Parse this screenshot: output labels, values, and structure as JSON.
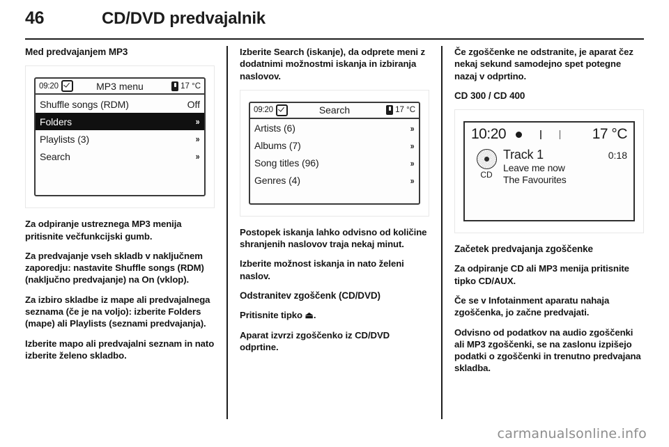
{
  "header": {
    "page_number": "46",
    "chapter_title": "CD/DVD predvajalnik"
  },
  "columns": {
    "left": {
      "heading": "Med predvajanjem MP3",
      "figure": {
        "name": "mp3-menu-screen",
        "clock": "09:20",
        "clock_icon": "clock-check-icon",
        "title": "MP3 menu",
        "temp_icon": "thermometer-icon",
        "temperature": "17 °C",
        "rows": [
          {
            "label": "Shuffle songs (RDM)",
            "value": "Off",
            "arrow": "",
            "selected": false
          },
          {
            "label": "Folders",
            "value": "",
            "arrow": "»",
            "selected": true
          },
          {
            "label": "Playlists (3)",
            "value": "",
            "arrow": "»",
            "selected": false
          },
          {
            "label": "Search",
            "value": "",
            "arrow": "»",
            "selected": false
          }
        ]
      },
      "paragraphs": [
        "Za odpiranje ustreznega MP3 menija pritisnite večfunkcijski gumb.",
        "Za predvajanje vseh skladb v naključnem zaporedju: nastavite Shuffle songs (RDM) (naključno predvajanje) na On (vklop).",
        "Za izbiro skladbe iz mape ali predvajalnega seznama (če je na voljo): izberite Folders (mape) ali Playlists (seznami predvajanja).",
        "Izberite mapo ali predvajalni seznam in nato izberite želeno skladbo."
      ]
    },
    "middle": {
      "intro": "Izberite Search (iskanje), da odprete meni z dodatnimi možnostmi iskanja in izbiranja naslovov.",
      "figure": {
        "name": "search-menu-screen",
        "clock": "09:20",
        "clock_icon": "clock-check-icon",
        "title": "Search",
        "temp_icon": "thermometer-icon",
        "temperature": "17 °C",
        "rows": [
          {
            "label": "Artists (6)",
            "value": "",
            "arrow": "»",
            "selected": false
          },
          {
            "label": "Albums (7)",
            "value": "",
            "arrow": "»",
            "selected": false
          },
          {
            "label": "Song titles (96)",
            "value": "",
            "arrow": "»",
            "selected": false
          },
          {
            "label": "Genres (4)",
            "value": "",
            "arrow": "»",
            "selected": false
          }
        ]
      },
      "paragraphs": [
        "Postopek iskanja lahko odvisno od količine shranjenih naslovov traja nekaj minut.",
        "Izberite možnost iskanja in nato želeni naslov."
      ],
      "heading2": "Odstranitev zgoščenk (CD/DVD)",
      "paragraphs2": [
        "Pritisnite tipko ⏏.",
        "Aparat izvrzi zgoščenko iz CD/DVD odprtine."
      ]
    },
    "right": {
      "intro": "Če zgoščenke ne odstranite, je aparat čez nekaj sekund samodejno spet potegne nazaj v odprtino.",
      "heading": "CD 300 / CD 400",
      "figure": {
        "name": "cd-playback-screen",
        "clock": "10:20",
        "status_icon": "disc-dot-icon",
        "temperature": "17 °C",
        "disc_icon": "cd-disc-icon",
        "disc_label": "CD",
        "track": "Track 1",
        "time": "0:18",
        "song": "Leave me now",
        "artist": "The Favourites"
      },
      "heading2": "Začetek predvajanja zgoščenke",
      "paragraphs": [
        "Za odpiranje CD ali MP3 menija pritisnite tipko CD/AUX.",
        "Če se v Infotainment aparatu nahaja zgoščenka, jo začne predvajati.",
        "Odvisno od podatkov na audio zgoščenki ali MP3 zgoščenki, se na zaslonu izpišejo podatki o zgoščenki in trenutno predvajana skladba."
      ]
    }
  },
  "watermark": "carmanualsonline.info"
}
